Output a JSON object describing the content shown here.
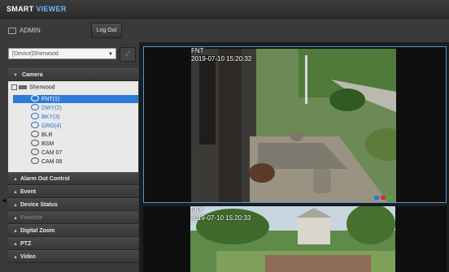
{
  "app": {
    "brand_part1": "SMART",
    "brand_part2": "VIEWER"
  },
  "user": {
    "name": "ADMIN",
    "logout_label": "Log Out"
  },
  "device_selector": {
    "value": "[Device]Sherwood",
    "pin_icon": "pin-icon"
  },
  "camera_panel": {
    "title": "Camera",
    "root": "Sherwood",
    "items": [
      {
        "label": "FNT(1)",
        "state": "selected"
      },
      {
        "label": "DWY(2)",
        "state": "recording"
      },
      {
        "label": "BKY(3)",
        "state": "recording"
      },
      {
        "label": "GRG(4)",
        "state": "recording"
      },
      {
        "label": "BLR",
        "state": "normal"
      },
      {
        "label": "BSM",
        "state": "normal"
      },
      {
        "label": "CAM 07",
        "state": "normal"
      },
      {
        "label": "CAM 08",
        "state": "normal"
      }
    ]
  },
  "panels": [
    {
      "label": "Alarm Out Control",
      "enabled": true
    },
    {
      "label": "Event",
      "enabled": true
    },
    {
      "label": "Device Status",
      "enabled": true
    },
    {
      "label": "Favorite",
      "enabled": false
    },
    {
      "label": "Digital Zoom",
      "enabled": true
    },
    {
      "label": "PTZ",
      "enabled": true
    },
    {
      "label": "Video",
      "enabled": true
    }
  ],
  "tiles": [
    {
      "name": "FNT",
      "timestamp": "2019-07-10 15:20:32"
    },
    {
      "name": "BKY",
      "timestamp": "2019-07-10 15:20:33"
    }
  ],
  "colors": {
    "accent": "#2e7ad8",
    "recording": "#2a72c8",
    "tile_border": "#4a9ae0"
  }
}
